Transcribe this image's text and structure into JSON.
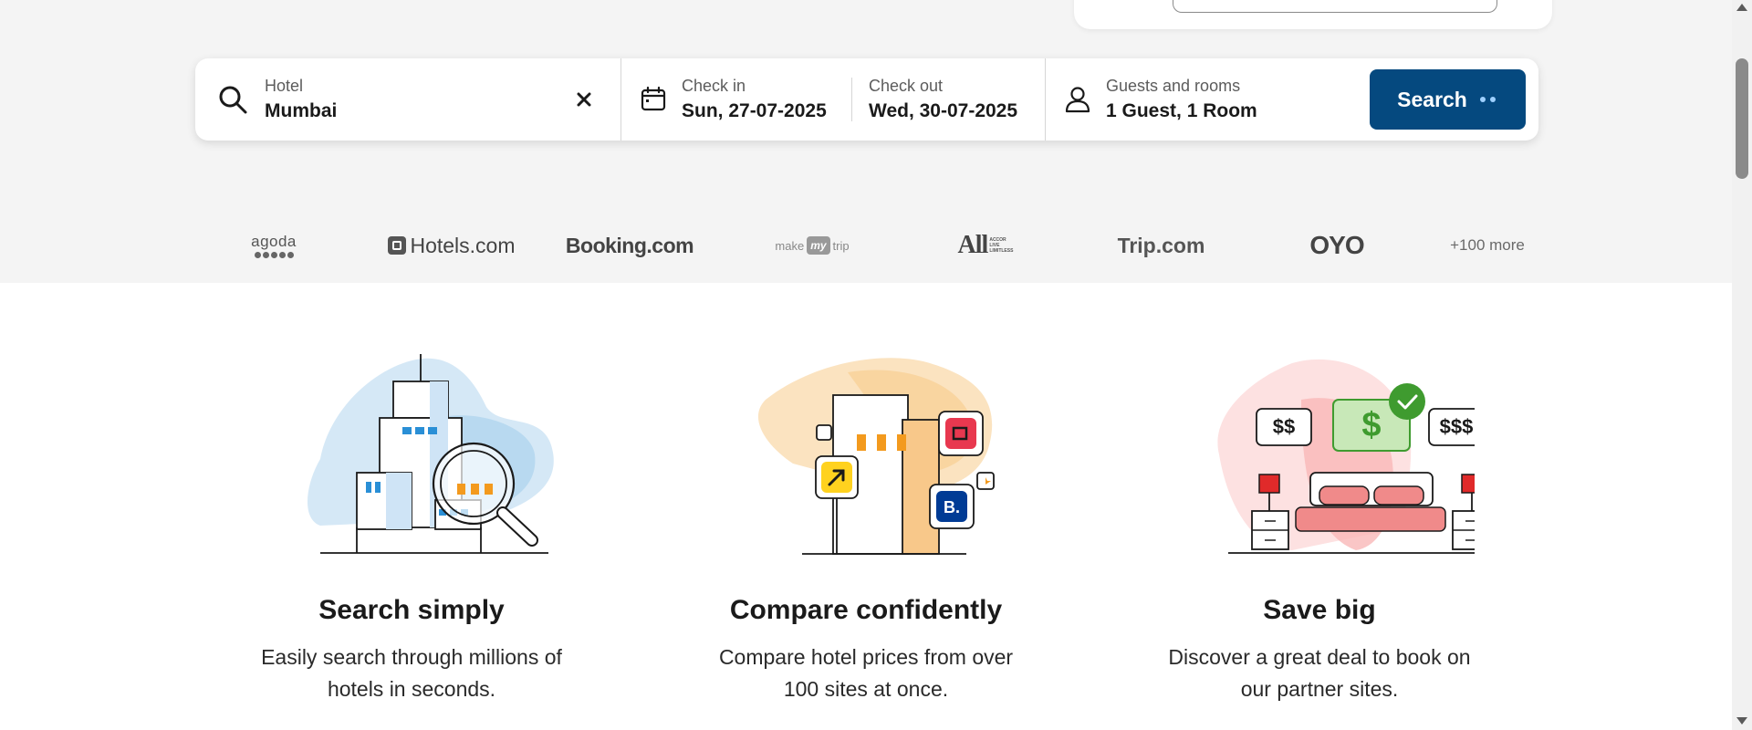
{
  "search": {
    "hotel_label": "Hotel",
    "hotel_value": "Mumbai",
    "checkin_label": "Check in",
    "checkin_value": "Sun, 27-07-2025",
    "checkout_label": "Check out",
    "checkout_value": "Wed, 30-07-2025",
    "guests_label": "Guests and rooms",
    "guests_value": "1 Guest, 1 Room",
    "button_label": "Search"
  },
  "partners": {
    "agoda": "agoda",
    "hotels": "Hotels.com",
    "booking": "Booking.com",
    "mmt_left": "make",
    "mmt_mid": "my",
    "mmt_right": "trip",
    "all": "All",
    "all_tag_1": "ACCOR",
    "all_tag_2": "LIVE",
    "all_tag_3": "LIMITLESS",
    "trip": "Trip.com",
    "oyo": "OYO",
    "more": "+100 more"
  },
  "features": [
    {
      "title": "Search simply",
      "description": "Easily search through millions of hotels in seconds."
    },
    {
      "title": "Compare confidently",
      "description": "Compare hotel prices from over 100 sites at once."
    },
    {
      "title": "Save big",
      "description": "Discover a great deal to book on our partner sites."
    }
  ],
  "illustration_text": {
    "price_low": "$$",
    "price_mid": "$",
    "price_high": "$$$",
    "booking_badge": "B."
  },
  "colors": {
    "primary": "#05497f",
    "background_band": "#f4f4f4",
    "accent_blue": "#2a8fd6",
    "accent_orange": "#f39a1e",
    "accent_green": "#3f9b2f",
    "accent_pink": "#f08a8a"
  },
  "icons": {
    "hotel_field": "search-icon",
    "clear": "close-icon",
    "dates": "calendar-icon",
    "guests": "person-icon",
    "button": "loading-dots-icon"
  }
}
